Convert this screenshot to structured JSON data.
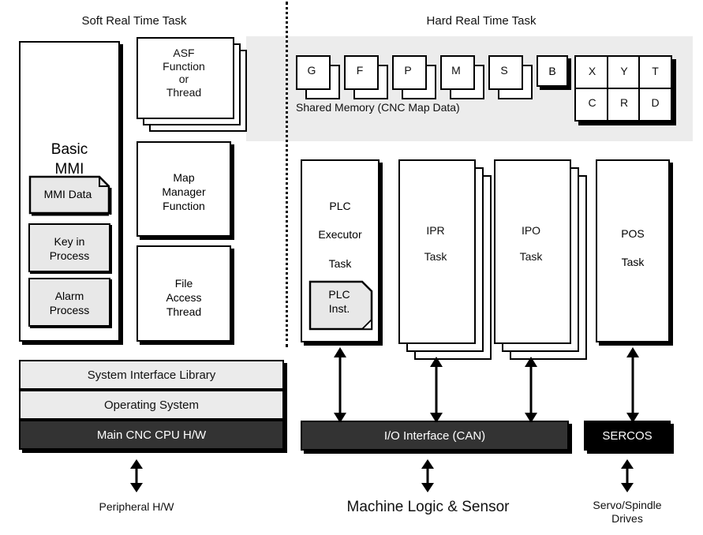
{
  "diagram": {
    "title_left": "Soft Real Time Task",
    "title_right": "Hard Real Time Task"
  },
  "soft_side": {
    "basic_mmi": {
      "label": "Basic\nMMI",
      "children": [
        {
          "label": "MMI Data",
          "shape": "document"
        },
        {
          "label": "Key in\nProcess",
          "shape": "rect"
        },
        {
          "label": "Alarm\nProcess",
          "shape": "rect"
        }
      ]
    },
    "modules": [
      {
        "label": "ASF\nFunction\nor\nThread",
        "stacked": 3
      },
      {
        "label": "Map\nManager\nFunction",
        "stacked": 1
      },
      {
        "label": "File\nAccess\nThread",
        "stacked": 1
      }
    ],
    "stack_layers": [
      {
        "label": "System Interface Library",
        "tone": "light"
      },
      {
        "label": "Operating System",
        "tone": "light"
      },
      {
        "label": "Main CNC CPU H/W",
        "tone": "dark"
      }
    ],
    "peripheral_label": "Peripheral H/W"
  },
  "hard_side": {
    "shared_memory": {
      "caption": "Shared Memory (CNC Map Data)",
      "code_blocks": [
        {
          "label": "G",
          "stacked": 2
        },
        {
          "label": "F",
          "stacked": 2
        },
        {
          "label": "P",
          "stacked": 2
        },
        {
          "label": "M",
          "stacked": 2
        },
        {
          "label": "S",
          "stacked": 2
        },
        {
          "label": "B",
          "stacked": 1
        }
      ],
      "axis_grid": {
        "row1": [
          "X",
          "Y",
          "T"
        ],
        "row2": [
          "C",
          "R",
          "D"
        ]
      }
    },
    "tasks": [
      {
        "label": "PLC\n\nExecutor\n\nTask",
        "stacked": 1,
        "inner": "PLC\nInst."
      },
      {
        "label": "IPR\n\nTask",
        "stacked": 3,
        "inner": null
      },
      {
        "label": "IPO\n\nTask",
        "stacked": 3,
        "inner": null
      },
      {
        "label": "POS\n\nTask",
        "stacked": 1,
        "inner": null
      }
    ],
    "io_interface": {
      "label": "I/O Interface (CAN)",
      "tone": "dark"
    },
    "sercos": {
      "label": "SERCOS",
      "tone": "black"
    },
    "machine_label": "Machine Logic & Sensor",
    "servo_label": "Servo/Spindle\nDrives"
  },
  "colors": {
    "panel_gray": "#ececec",
    "subbox_gray": "#e8e8e8",
    "layer_light": "#ebebeb",
    "layer_dark": "#333333",
    "layer_black": "#000000",
    "outline": "#000000"
  }
}
